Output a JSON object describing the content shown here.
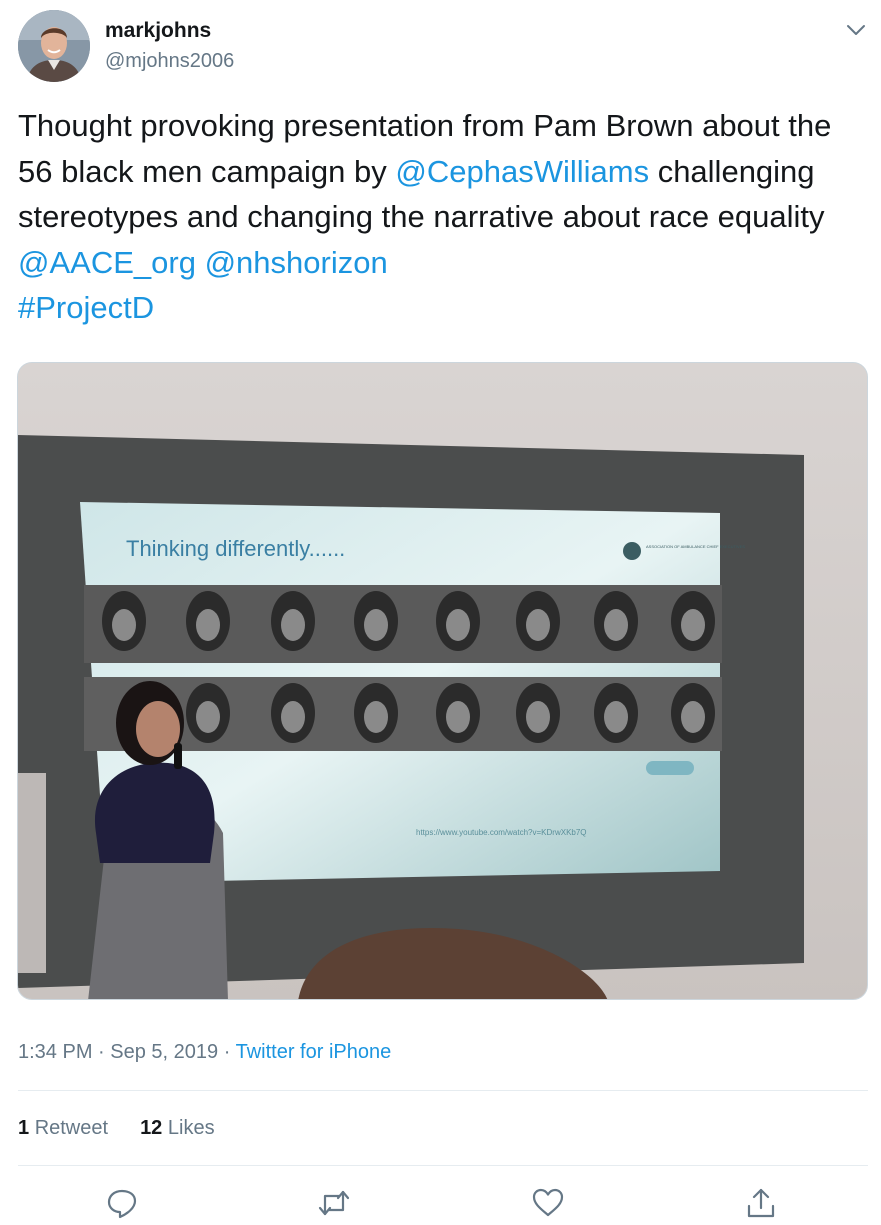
{
  "author": {
    "display_name": "markjohns",
    "handle": "@mjohns2006"
  },
  "tweet": {
    "text_1": "Thought provoking presentation from Pam Brown about the 56 black men campaign by ",
    "mention_1": "@CephasWilliams",
    "text_2": " challenging stereotypes and changing the narrative about race equality ",
    "mention_2": "@AACE_org",
    "mention_3": "@nhshorizon",
    "hashtag": "#ProjectD"
  },
  "media": {
    "slide_title": "Thinking differently......",
    "slide_logo_text": "ASSOCIATION OF AMBULANCE CHIEF EXECUTIVES",
    "slide_url": "https://www.youtube.com/watch?v=KDrwXKb7Q"
  },
  "meta": {
    "time": "1:34 PM",
    "separator": "·",
    "date": "Sep 5, 2019",
    "source": "Twitter for iPhone"
  },
  "stats": {
    "retweets_count": "1",
    "retweets_label": "Retweet",
    "likes_count": "12",
    "likes_label": "Likes"
  },
  "icons": {
    "more": "chevron-down-icon",
    "reply": "reply-icon",
    "retweet": "retweet-icon",
    "like": "heart-icon",
    "share": "share-icon"
  },
  "colors": {
    "link": "#1b95e0",
    "secondary_text": "#657786",
    "primary_text": "#14171a",
    "divider": "#e6ecf0"
  }
}
